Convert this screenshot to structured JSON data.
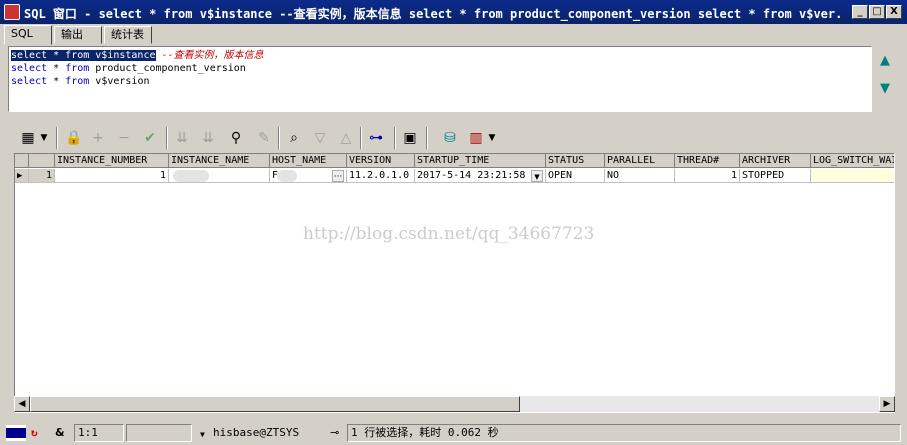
{
  "window": {
    "title": "SQL 窗口 - select * from v$instance --查看实例，版本信息 select * from product_component_version select * from v$ver...",
    "minimize": "_",
    "maximize": "□",
    "close": "X"
  },
  "tabs": [
    "SQL",
    "输出",
    "统计表"
  ],
  "editor": {
    "line1_code": "select * from v$instance",
    "line1_comment": " --查看实例，版本信息",
    "line2_kw1": "select",
    "line2_mid": " * ",
    "line2_kw2": "from",
    "line2_rest": " product_component_version",
    "line3_kw1": "select",
    "line3_mid": " * ",
    "line3_kw2": "from",
    "line3_rest": " v$version"
  },
  "toolbar_icons": [
    "grid-icon",
    "lock-icon",
    "plus-icon",
    "minus-icon",
    "check-icon",
    "arrow-down-double-icon",
    "arrow-down-double-alt-icon",
    "binoculars-icon",
    "eraser-icon",
    "query-icon",
    "filter-down-icon",
    "filter-up-icon",
    "tree-icon",
    "save-icon",
    "database-icon",
    "chart-icon"
  ],
  "grid": {
    "columns": [
      "INSTANCE_NUMBER",
      "INSTANCE_NAME",
      "HOST_NAME",
      "VERSION",
      "STARTUP_TIME",
      "STATUS",
      "PARALLEL",
      "THREAD#",
      "ARCHIVER",
      "LOG_SWITCH_WAIT"
    ],
    "row": {
      "row_num": "1",
      "instance_number": "1",
      "instance_name": "",
      "host_name": "F",
      "host_ellipsis": "···",
      "version": "11.2.0.1.0",
      "startup_time": "2017-5-14 23:21:58",
      "status": "OPEN",
      "parallel": "NO",
      "thread": "1",
      "archiver": "STOPPED",
      "log_switch_wait": ""
    },
    "watermark": "http://blog.csdn.net/qq_34667723"
  },
  "statusbar": {
    "position": "1:1",
    "connection": "hisbase@ZTSYS",
    "message": "1 行被选择，耗时 0.062 秒"
  }
}
